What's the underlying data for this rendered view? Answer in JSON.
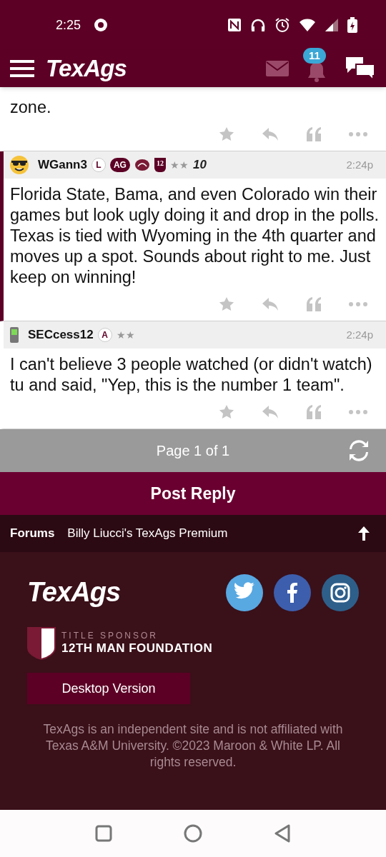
{
  "status_bar": {
    "time": "2:25"
  },
  "header": {
    "logo": "TexAgs",
    "notifications": "11"
  },
  "posts": [
    {
      "kind": "fragment",
      "highlighted": false,
      "body": "zone."
    },
    {
      "kind": "full",
      "highlighted": true,
      "avatar": {
        "kind": "sunglasses"
      },
      "user": "WGann3",
      "time": "2:24p",
      "badges": [
        {
          "kind": "circle",
          "text": "L"
        },
        {
          "kind": "pill",
          "text": "AG"
        },
        {
          "kind": "mascot"
        },
        {
          "kind": "shield",
          "text": "12"
        },
        {
          "kind": "stars",
          "text": "★★"
        },
        {
          "kind": "logo",
          "text": "10"
        }
      ],
      "body": "Florida State, Bama, and even Colorado win their games but look ugly doing it and drop in the polls. Texas is tied with Wyoming in the 4th quarter and moves up a spot. Sounds about right to me. Just keep on winning!"
    },
    {
      "kind": "full",
      "highlighted": false,
      "avatar": {
        "kind": "phone"
      },
      "user": "SECcess12",
      "time": "2:24p",
      "badges": [
        {
          "kind": "circle",
          "text": "A"
        },
        {
          "kind": "stars",
          "text": "★★"
        }
      ],
      "body": "I can't believe 3 people watched (or didn't watch) tu and said, \"Yep, this is the number 1 team\"."
    }
  ],
  "pager": {
    "label": "Page 1 of 1"
  },
  "post_reply": "Post Reply",
  "breadcrumb": [
    "Forums",
    "Billy Liucci's TexAgs Premium"
  ],
  "footer": {
    "logo": "TexAgs",
    "sponsor_label": "TITLE SPONSOR",
    "sponsor_name": "12TH MAN FOUNDATION",
    "desktop_button": "Desktop Version",
    "legal": "TexAgs is an independent site and is not affiliated with Texas A&M University. ©2023 Maroon & White LP. All rights reserved."
  }
}
